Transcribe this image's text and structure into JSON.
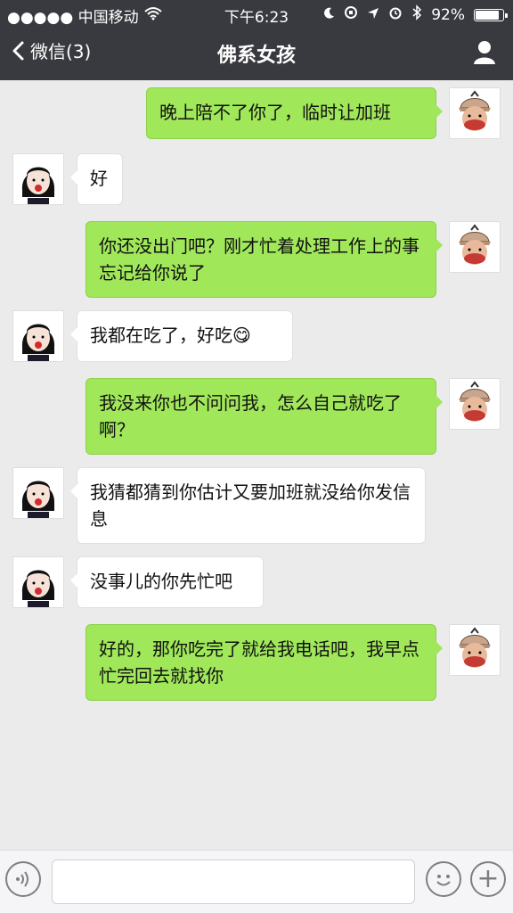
{
  "status_bar": {
    "carrier": "●●●●● 中国移动",
    "time": "下午6:23",
    "battery": "92%",
    "battery_level": 0.92
  },
  "header": {
    "back_label": "微信(3)",
    "title": "佛系女孩"
  },
  "messages": [
    {
      "side": "right",
      "text": "晚上陪不了你了，临时让加班"
    },
    {
      "side": "left",
      "text": "好"
    },
    {
      "side": "right",
      "text": "你还没出门吧？刚才忙着处理工作上的事忘记给你说了"
    },
    {
      "side": "left",
      "text": "我都在吃了，好吃😋"
    },
    {
      "side": "right",
      "text": "我没来你也不问问我，怎么自己就吃了啊？"
    },
    {
      "side": "left",
      "text": "我猜都猜到你估计又要加班就没给你发信息"
    },
    {
      "side": "left",
      "text": "没事儿的你先忙吧"
    },
    {
      "side": "right",
      "text": "好的，那你吃完了就给我电话吧，我早点忙完回去就找你"
    }
  ],
  "colors": {
    "header_bg": "#393a3f",
    "chat_bg": "#ebebeb",
    "bubble_right": "#a0e75a",
    "bubble_left": "#ffffff"
  }
}
